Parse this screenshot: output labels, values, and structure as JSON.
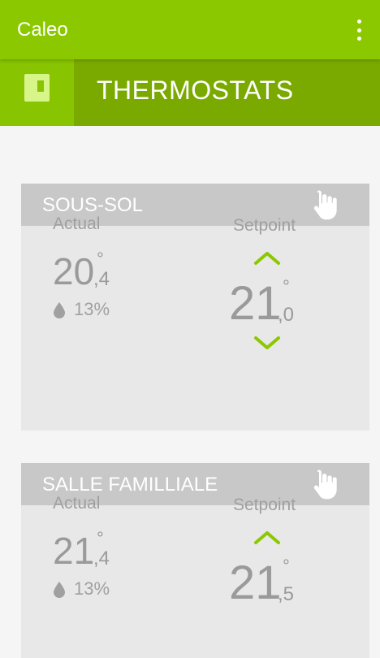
{
  "app": {
    "title": "Caleo",
    "menu_icon": "more-vert-icon"
  },
  "section": {
    "title": "THERMOSTATS",
    "icon": "thermostat-panel-icon"
  },
  "colors": {
    "appbar": "#8bc800",
    "section_bar": "#7aaa00",
    "section_icon_bg": "#89c400",
    "accent_green": "#8bc800",
    "card_bg": "#e8e8e8",
    "card_header": "#c8c8c8",
    "text_grey": "#9a9a9a"
  },
  "labels": {
    "actual": "Actual",
    "setpoint": "Setpoint"
  },
  "thermostats": [
    {
      "name": "SOUS-SOL",
      "actual_int": "20",
      "actual_dec": ",4",
      "degree": "°",
      "humidity": "13%",
      "setpoint_int": "21",
      "setpoint_dec": ",0"
    },
    {
      "name": "SALLE FAMILLIALE",
      "actual_int": "21",
      "actual_dec": ",4",
      "degree": "°",
      "humidity": "13%",
      "setpoint_int": "21",
      "setpoint_dec": ",5"
    }
  ]
}
